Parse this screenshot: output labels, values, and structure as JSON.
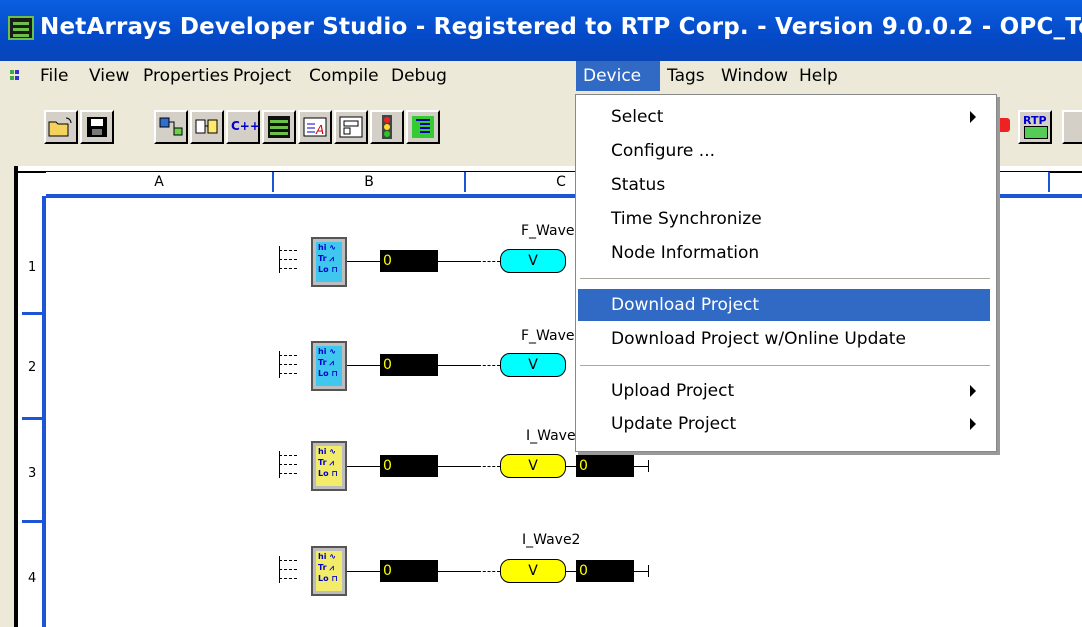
{
  "window": {
    "title": "NetArrays Developer Studio - Registered to RTP Corp. - Version 9.0.0.2   - OPC_Tes"
  },
  "menu": [
    {
      "label": "File"
    },
    {
      "label": "View"
    },
    {
      "label": "Properties"
    },
    {
      "label": "Project"
    },
    {
      "label": "Compile"
    },
    {
      "label": "Debug"
    },
    {
      "label": "Device"
    },
    {
      "label": "Tags"
    },
    {
      "label": "Window"
    },
    {
      "label": "Help"
    }
  ],
  "toolbar": {
    "buttons": [
      "open-folder-icon",
      "save-disk-icon",
      "flow-icon",
      "function-block-icon",
      "cplusplus-icon",
      "netarrays-icon",
      "text-icon",
      "form-icon",
      "traffic-light-icon",
      "tree-icon",
      "stop-icon",
      "rtp-fifo-icon"
    ],
    "rtp_label": "RTP",
    "cpp_label": "C++"
  },
  "sheet": {
    "columns": [
      "A",
      "B",
      "C"
    ],
    "rows": [
      {
        "num": "1",
        "tag": "F_Wave",
        "value": "0",
        "color": "#00ffff"
      },
      {
        "num": "2",
        "tag": "F_Wave",
        "value": "0",
        "color": "#00ffff"
      },
      {
        "num": "3",
        "tag": "I_Wave",
        "value": "0",
        "out_value": "0",
        "color": "#ffff00"
      },
      {
        "num": "4",
        "tag": "I_Wave2",
        "value": "0",
        "out_value": "0",
        "color": "#ffff00"
      }
    ],
    "pill_label": "V",
    "block_labels": {
      "hi": "hi",
      "tr": "Tr",
      "lo": "Lo"
    }
  },
  "device_menu": [
    {
      "label": "Select",
      "submenu": true
    },
    {
      "label": "Configure ...",
      "submenu": false
    },
    {
      "label": "Status",
      "submenu": false
    },
    {
      "label": "Time Synchronize",
      "submenu": false
    },
    {
      "label": "Node Information",
      "submenu": false
    },
    {
      "label": "Download Project",
      "submenu": false,
      "highlighted": true
    },
    {
      "label": "Download Project w/Online Update",
      "submenu": false
    },
    {
      "label": "Upload Project",
      "submenu": true
    },
    {
      "label": "Update Project",
      "submenu": true
    }
  ]
}
